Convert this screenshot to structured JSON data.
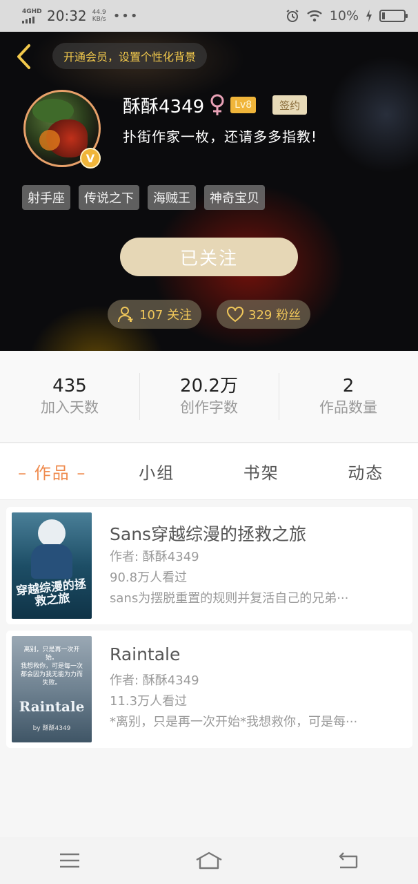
{
  "status_bar": {
    "network": "4GHD",
    "time": "20:32",
    "speed_value": "44.9",
    "speed_unit": "KB/s",
    "dots": "•••",
    "battery": "10%"
  },
  "header": {
    "vip_banner": "开通会员，设置个性化背景",
    "username": "酥酥4349",
    "gender_symbol": "♀",
    "level": "Lv8",
    "sign_badge": "签约",
    "bio": "扑街作家一枚，还请多多指教!",
    "verified_badge": "V",
    "tags": [
      "射手座",
      "传说之下",
      "海贼王",
      "神奇宝贝"
    ],
    "follow_button": "已关注",
    "following_pill": "107 关注",
    "fans_pill": "329 粉丝"
  },
  "stats": [
    {
      "value": "435",
      "label": "加入天数"
    },
    {
      "value": "20.2万",
      "label": "创作字数"
    },
    {
      "value": "2",
      "label": "作品数量"
    }
  ],
  "tabs": [
    {
      "label": "– 作品 –",
      "active": true
    },
    {
      "label": "小组",
      "active": false
    },
    {
      "label": "书架",
      "active": false
    },
    {
      "label": "动态",
      "active": false
    }
  ],
  "works": [
    {
      "title": "Sans穿越综漫的拯救之旅",
      "author": "作者: 酥酥4349",
      "views": "90.8万人看过",
      "description": "sans为摆脱重置的规则并复活自己的兄弟···",
      "cover_text": "穿越综漫的拯救之旅"
    },
    {
      "title": "Raintale",
      "author": "作者: 酥酥4349",
      "views": "11.3万人看过",
      "description": "*离别，只是再一次开始*我想救你，可是每···",
      "cover_top_text": "离别，只是再一次开始。",
      "cover_top_text2": "我想救你，可是每一次都会因为我无能为力而失败。",
      "cover_title": "Raintale",
      "cover_sub": "by 酥酥4349"
    }
  ],
  "colors": {
    "accent_orange": "#ef8b4e",
    "gold": "#f0c75a",
    "follow_button_bg": "#e6d7b6"
  }
}
